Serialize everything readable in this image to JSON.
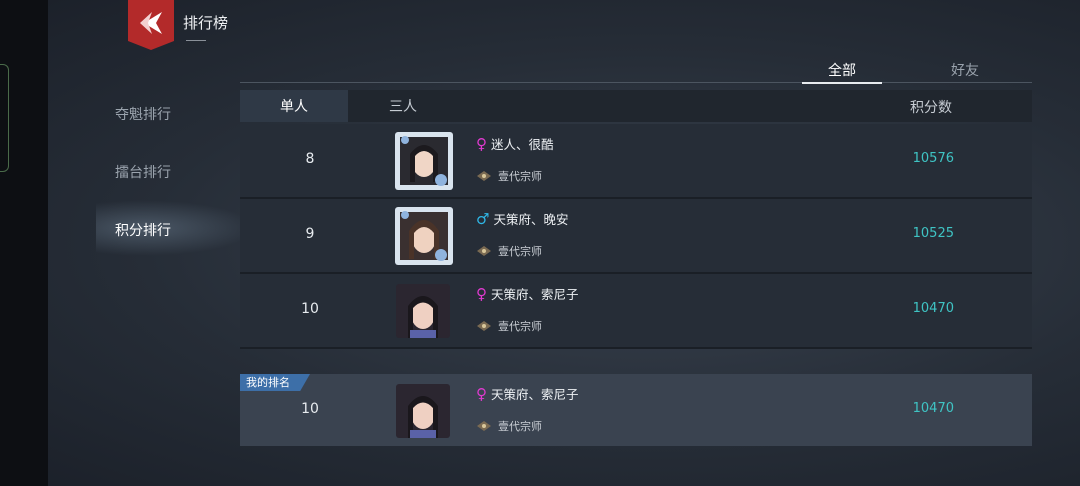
{
  "header": {
    "title": "排行榜"
  },
  "sidebar": {
    "items": [
      {
        "label": "夺魁排行",
        "active": false
      },
      {
        "label": "擂台排行",
        "active": false
      },
      {
        "label": "积分排行",
        "active": true
      }
    ]
  },
  "scope_tabs": [
    {
      "label": "全部",
      "active": true
    },
    {
      "label": "好友",
      "active": false
    }
  ],
  "table": {
    "modes": [
      {
        "label": "单人",
        "active": true
      },
      {
        "label": "三人",
        "active": false
      }
    ],
    "score_header": "积分数",
    "rows": [
      {
        "rank": "8",
        "gender": "♀",
        "gender_type": "f",
        "name": "迷人、很酷",
        "title": "壹代宗师",
        "score": "10576",
        "avatar": "female-portrait-framed"
      },
      {
        "rank": "9",
        "gender": "♂",
        "gender_type": "m",
        "name": "天策府、晚安",
        "title": "壹代宗师",
        "score": "10525",
        "avatar": "female-portrait-framed"
      },
      {
        "rank": "10",
        "gender": "♀",
        "gender_type": "f",
        "name": "天策府、索尼子",
        "title": "壹代宗师",
        "score": "10470",
        "avatar": "female-portrait"
      }
    ]
  },
  "my_rank": {
    "badge": "我的排名",
    "rank": "10",
    "gender": "♀",
    "gender_type": "f",
    "name": "天策府、索尼子",
    "title": "壹代宗师",
    "score": "10470",
    "avatar": "female-portrait"
  },
  "colors": {
    "accent_score": "#3fc4c4",
    "back_button": "#b32a2a",
    "female": "#e03ad0",
    "male": "#2fb7e6",
    "my_badge": "#3d6fa8"
  }
}
